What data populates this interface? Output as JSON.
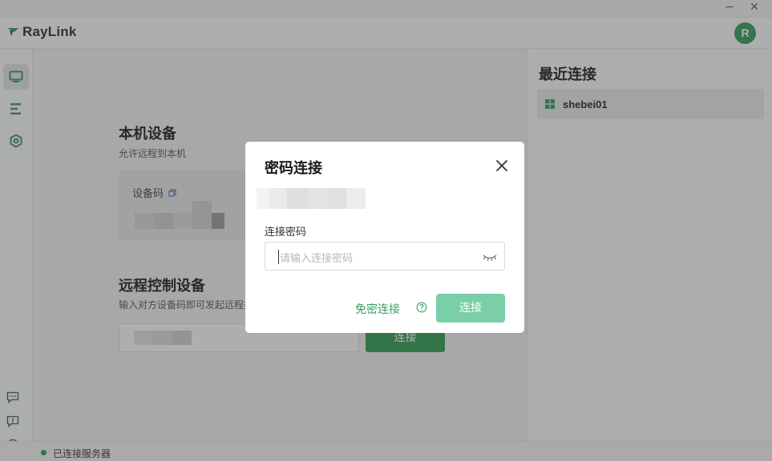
{
  "window": {
    "minimize": "−",
    "close": "✕"
  },
  "header": {
    "brand": "RayLink",
    "avatar_initial": "R"
  },
  "sidebar": {
    "items": [
      {
        "name": "remote-desktop",
        "active": true
      },
      {
        "name": "device-list",
        "active": false
      },
      {
        "name": "settings",
        "active": false
      }
    ],
    "bottom": [
      "chat-icon",
      "feedback-icon",
      "compass-icon"
    ]
  },
  "local": {
    "title": "本机设备",
    "subtitle": "允许远程到本机",
    "device_code_label": "设备码"
  },
  "remote": {
    "title": "远程控制设备",
    "subtitle": "输入对方设备码即可发起远程控制",
    "connect_label": "连接"
  },
  "recent": {
    "title": "最近连接",
    "items": [
      {
        "name": "shebei01",
        "os": "windows"
      }
    ]
  },
  "status": {
    "text": "已连接服务器"
  },
  "dialog": {
    "title": "密码连接",
    "password_label": "连接密码",
    "password_placeholder": "请输入连接密码",
    "nopwd_label": "免密连接",
    "connect_label": "连接"
  },
  "colors": {
    "brand_green": "#2e9c58",
    "button_disabled": "#7acfa8",
    "link_green": "#37a163"
  }
}
